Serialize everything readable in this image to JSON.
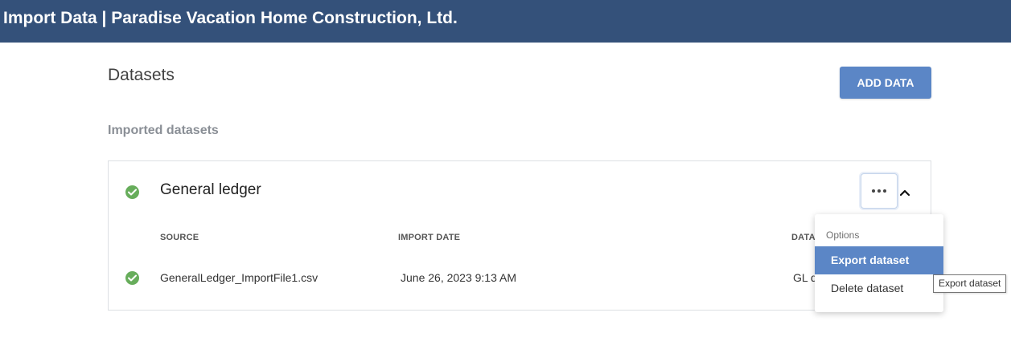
{
  "window": {
    "title": "Import Data | Paradise Vacation Home Construction, Ltd."
  },
  "page": {
    "title": "Datasets",
    "add_button": "ADD DATA",
    "section_title": "Imported datasets"
  },
  "dataset": {
    "name": "General ledger",
    "status": "success",
    "columns": {
      "source": "SOURCE",
      "import_date": "IMPORT DATE",
      "data": "DATA"
    },
    "row": {
      "source": "GeneralLedger_ImportFile1.csv",
      "import_date": "June 26, 2023 9:13 AM",
      "data": "GL d"
    }
  },
  "menu": {
    "caption": "Options",
    "items": [
      {
        "label": "Export dataset",
        "highlighted": true
      },
      {
        "label": "Delete dataset",
        "highlighted": false
      }
    ]
  },
  "tooltip": {
    "text": "Export dataset"
  },
  "colors": {
    "header": "#34517a",
    "accent": "#5b86c6",
    "success": "#67ad5b"
  },
  "icons": {
    "status": "check-circle-icon",
    "more": "more-horizontal-icon",
    "collapse": "chevron-up-icon"
  }
}
